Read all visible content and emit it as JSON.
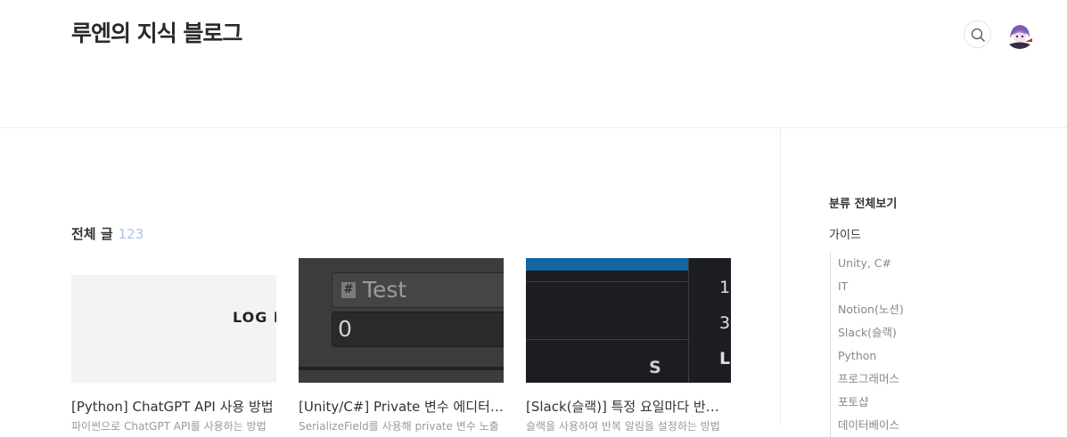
{
  "header": {
    "blog_title": "루엔의 지식 블로그",
    "search_icon": "search-icon",
    "avatar_icon": "avatar-image"
  },
  "main": {
    "section_label": "전체 글",
    "post_count": "123",
    "posts": [
      {
        "title": "[Python] ChatGPT API 사용 방법",
        "excerpt": "파이썬으로 ChatGPT API를 사용하는 방법",
        "thumb_text": "LOG I"
      },
      {
        "title": "[Unity/C#] Private 변수 에디터에 표시하기",
        "excerpt": "SerializeField를 사용해 private 변수 노출",
        "thumb_field_label": "Test",
        "thumb_field_value": "0"
      },
      {
        "title": "[Slack(슬랙)] 특정 요일마다 반복 알림 설정",
        "excerpt": "슬랙을 사용하여 반복 알림을 설정하는 방법",
        "thumb_letters": [
          "S",
          "1",
          "3",
          "L"
        ]
      }
    ]
  },
  "sidebar": {
    "heading": "분류 전체보기",
    "top_category": "가이드",
    "subcategories": [
      "Unity, C#",
      "IT",
      "Notion(노션)",
      "Slack(슬랙)",
      "Python",
      "프로그래머스",
      "포토샵",
      "데이터베이스"
    ]
  },
  "colors": {
    "count_accent": "#a7c4ee",
    "divider": "#ececec",
    "slack_blue": "#1264a3"
  }
}
